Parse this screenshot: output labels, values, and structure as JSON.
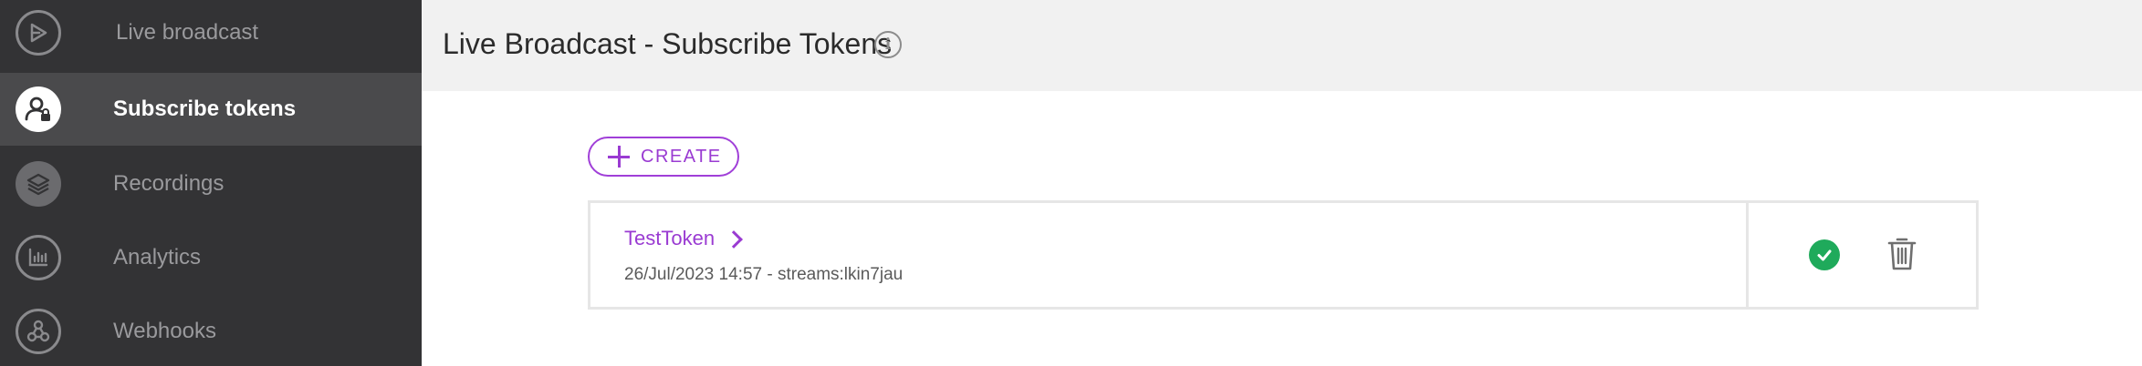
{
  "sidebar": {
    "items": [
      {
        "label": "Live broadcast",
        "icon": "live-broadcast-icon",
        "active": false
      },
      {
        "label": "Subscribe tokens",
        "icon": "user-lock-icon",
        "active": true
      },
      {
        "label": "Recordings",
        "icon": "layers-icon",
        "active": false
      },
      {
        "label": "Analytics",
        "icon": "analytics-icon",
        "active": false
      },
      {
        "label": "Webhooks",
        "icon": "webhooks-icon",
        "active": false
      }
    ]
  },
  "header": {
    "title": "Live Broadcast - Subscribe Tokens",
    "info_icon": "info-icon",
    "info_glyph": "i"
  },
  "toolbar": {
    "create_label": "CREATE"
  },
  "tokens": [
    {
      "name": "TestToken",
      "meta": "26/Jul/2023 14:57 - streams:lkin7jau",
      "status": "active",
      "status_icon": "check-circle-icon",
      "delete_icon": "trash-icon"
    }
  ],
  "colors": {
    "sidebar_bg": "#333335",
    "sidebar_active_bg": "#4a4a4c",
    "accent": "#9a3bd2",
    "status_ok": "#1faa5b",
    "header_bg": "#f1f1f1"
  }
}
